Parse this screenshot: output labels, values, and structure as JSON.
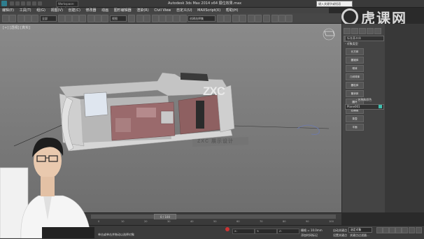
{
  "titlebar": {
    "workspace": "Workspace: Default",
    "title": "Autodesk 3ds Max 2014 x64    展位效果.max",
    "search": "键入关键字或短语"
  },
  "menu": {
    "items": [
      "编辑(E)",
      "工具(T)",
      "组(G)",
      "视图(V)",
      "创建(C)",
      "修改器",
      "动画",
      "图形编辑器",
      "渲染(R)",
      "Civil View",
      "自定义(U)",
      "MAXScript(X)",
      "帮助(H)"
    ]
  },
  "toolbar": {
    "filter": "全部",
    "view": "视图",
    "selection_set": "创建选择集"
  },
  "watermark": {
    "brand": "虎课网"
  },
  "viewport": {
    "label": "[+] [透视] [真实]",
    "booth_logo": "ZXC",
    "booth_sign": "ZXC 展示设计"
  },
  "command_panel": {
    "category": "标准基本体",
    "rollout": "- 对象类型",
    "auto_grid": "自动栅格",
    "buttons": [
      "长方体",
      "圆锥体",
      "球体",
      "几何球体",
      "圆柱体",
      "管状体",
      "圆环",
      "四棱锥",
      "茶壶",
      "平面"
    ],
    "name_color_title": "- 名称和颜色",
    "object_name": "Plane001"
  },
  "timeline": {
    "frame": "0 / 100",
    "ticks": [
      "0",
      "10",
      "20",
      "30",
      "40",
      "50",
      "60",
      "70",
      "80",
      "90",
      "100"
    ]
  },
  "status": {
    "x": "X:",
    "y": "Y:",
    "z": "Z:",
    "grid": "栅格 = 10.0mm",
    "auto_key": "自动关键点",
    "selected": "选定对象",
    "set_key": "设置关键点",
    "key_filter": "关键点过滤器...",
    "message": "单击或单击并拖动以选择对象",
    "add_time_tag": "添加时间标记"
  },
  "colors": {
    "viewport_bg": "#7a7a7a",
    "booth_body": "#c8c8c8",
    "booth_interior": "#9a6a6c",
    "accent": "#3fc0b0"
  }
}
